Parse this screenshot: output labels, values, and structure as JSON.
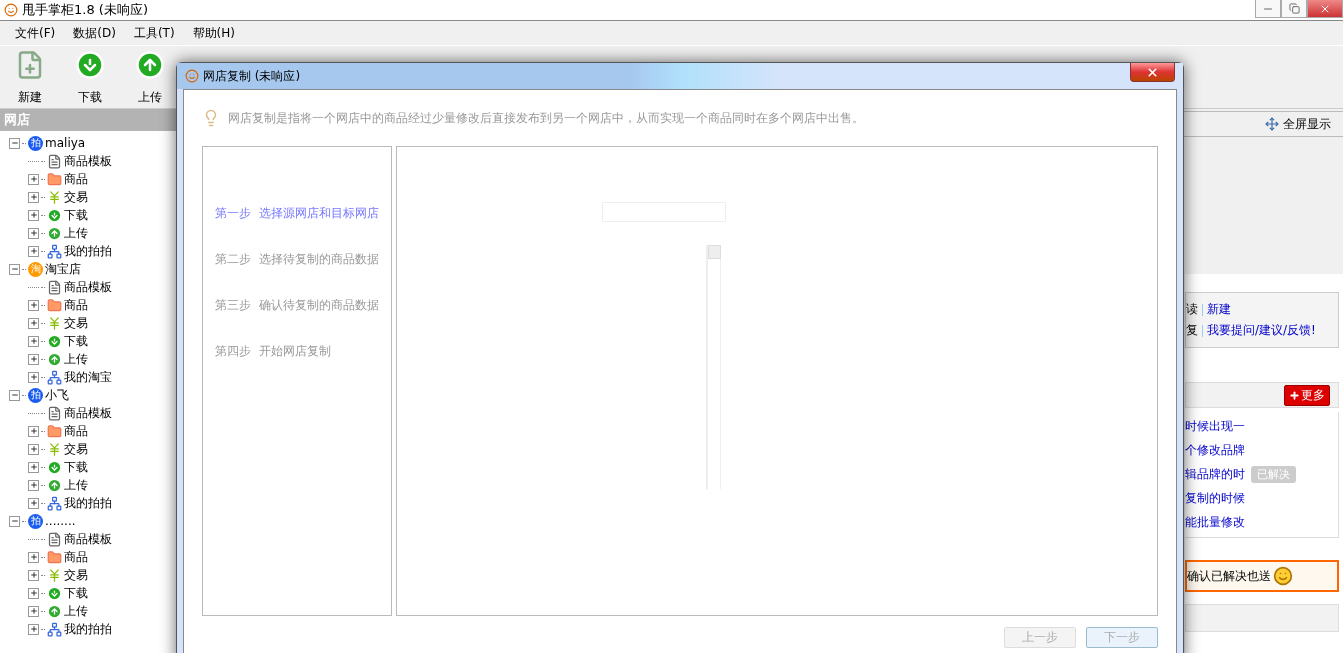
{
  "window": {
    "title": "甩手掌柜1.8 (未响应)"
  },
  "menu": [
    "文件(F)",
    "数据(D)",
    "工具(T)",
    "帮助(H)"
  ],
  "toolbar": [
    {
      "label": "新建",
      "kind": "new"
    },
    {
      "label": "下载",
      "kind": "download"
    },
    {
      "label": "上传",
      "kind": "upload"
    }
  ],
  "sidebar": {
    "title": "网店",
    "shops": [
      {
        "name": "maliya",
        "badge": "拍",
        "kind": "paipai",
        "expanded": true,
        "children": [
          {
            "label": "商品模板",
            "kind": "template"
          },
          {
            "label": "商品",
            "kind": "goods",
            "expanded": false
          },
          {
            "label": "交易",
            "kind": "trade",
            "expanded": false
          },
          {
            "label": "下载",
            "kind": "download",
            "expanded": false
          },
          {
            "label": "上传",
            "kind": "upload",
            "expanded": false
          },
          {
            "label": "我的拍拍",
            "kind": "network",
            "expanded": false
          }
        ]
      },
      {
        "name": "淘宝店",
        "badge": "淘",
        "kind": "taobao",
        "expanded": true,
        "children": [
          {
            "label": "商品模板",
            "kind": "template"
          },
          {
            "label": "商品",
            "kind": "goods",
            "expanded": false
          },
          {
            "label": "交易",
            "kind": "trade",
            "expanded": false
          },
          {
            "label": "下载",
            "kind": "download",
            "expanded": false
          },
          {
            "label": "上传",
            "kind": "upload",
            "expanded": false
          },
          {
            "label": "我的淘宝",
            "kind": "network",
            "expanded": false
          }
        ]
      },
      {
        "name": "小飞",
        "badge": "拍",
        "kind": "paipai",
        "expanded": true,
        "children": [
          {
            "label": "商品模板",
            "kind": "template"
          },
          {
            "label": "商品",
            "kind": "goods",
            "expanded": false
          },
          {
            "label": "交易",
            "kind": "trade",
            "expanded": false
          },
          {
            "label": "下载",
            "kind": "download",
            "expanded": false
          },
          {
            "label": "上传",
            "kind": "upload",
            "expanded": false
          },
          {
            "label": "我的拍拍",
            "kind": "network",
            "expanded": false
          }
        ]
      },
      {
        "name": "........",
        "badge": "拍",
        "kind": "paipai",
        "expanded": true,
        "children": [
          {
            "label": "商品模板",
            "kind": "template"
          },
          {
            "label": "商品",
            "kind": "goods",
            "expanded": false
          },
          {
            "label": "交易",
            "kind": "trade",
            "expanded": false
          },
          {
            "label": "下载",
            "kind": "download",
            "expanded": false
          },
          {
            "label": "上传",
            "kind": "upload",
            "expanded": false
          },
          {
            "label": "我的拍拍",
            "kind": "network",
            "expanded": false
          }
        ]
      }
    ]
  },
  "right_panel": {
    "fullscreen": "全屏显示",
    "links": [
      {
        "prefix": "读",
        "link": "新建"
      },
      {
        "prefix": "复",
        "link": "我要提问/建议/反馈!"
      }
    ],
    "more_button": "更多",
    "questions": [
      {
        "text": "时候出现一"
      },
      {
        "text": "个修改品牌"
      },
      {
        "text": "辑品牌的时",
        "badge": "已解决"
      },
      {
        "text": "复制的时候"
      },
      {
        "text": "能批量修改"
      }
    ],
    "notice": "确认已解决也送"
  },
  "dialog": {
    "title": "网店复制 (未响应)",
    "hint": "网店复制是指将一个网店中的商品经过少量修改后直接发布到另一个网店中，从而实现一个商品同时在多个网店中出售。",
    "steps": [
      {
        "label": "第一步  选择源网店和目标网店",
        "selected": true
      },
      {
        "label": "第二步  选择待复制的商品数据",
        "selected": false
      },
      {
        "label": "第三步  确认待复制的商品数据",
        "selected": false
      },
      {
        "label": "第四步  开始网店复制",
        "selected": false
      }
    ],
    "buttons": [
      {
        "label": "上一步",
        "disabled": true
      },
      {
        "label": "下一步",
        "disabled": false
      }
    ]
  }
}
